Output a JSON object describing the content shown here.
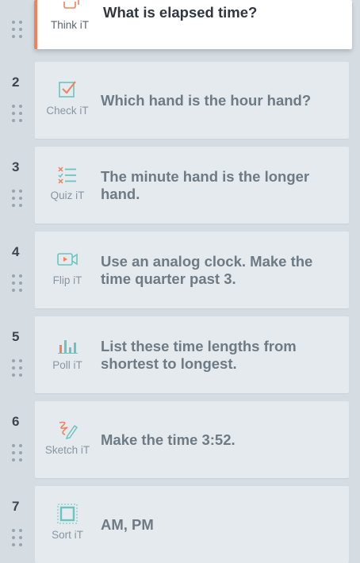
{
  "items": [
    {
      "number": "",
      "tool": "Think iT",
      "icon": "think-icon",
      "text": "What is elapsed time?",
      "active": true
    },
    {
      "number": "2",
      "tool": "Check iT",
      "icon": "check-icon",
      "text": "Which hand is the hour hand?"
    },
    {
      "number": "3",
      "tool": "Quiz iT",
      "icon": "quiz-icon",
      "text": "The minute hand is the longer hand."
    },
    {
      "number": "4",
      "tool": "Flip iT",
      "icon": "flip-icon",
      "text": "Use an analog clock. Make the time quarter past 3."
    },
    {
      "number": "5",
      "tool": "Poll iT",
      "icon": "poll-icon",
      "text": "List these time lengths from shortest to longest."
    },
    {
      "number": "6",
      "tool": "Sketch iT",
      "icon": "sketch-icon",
      "text": "Make the time 3:52."
    },
    {
      "number": "7",
      "tool": "Sort iT",
      "icon": "sort-icon",
      "text": "AM, PM"
    }
  ],
  "colors": {
    "accent": "#f3805c",
    "icon_teal": "#6cc4c1",
    "background": "#d5dde3",
    "card": "#e4eaee"
  }
}
